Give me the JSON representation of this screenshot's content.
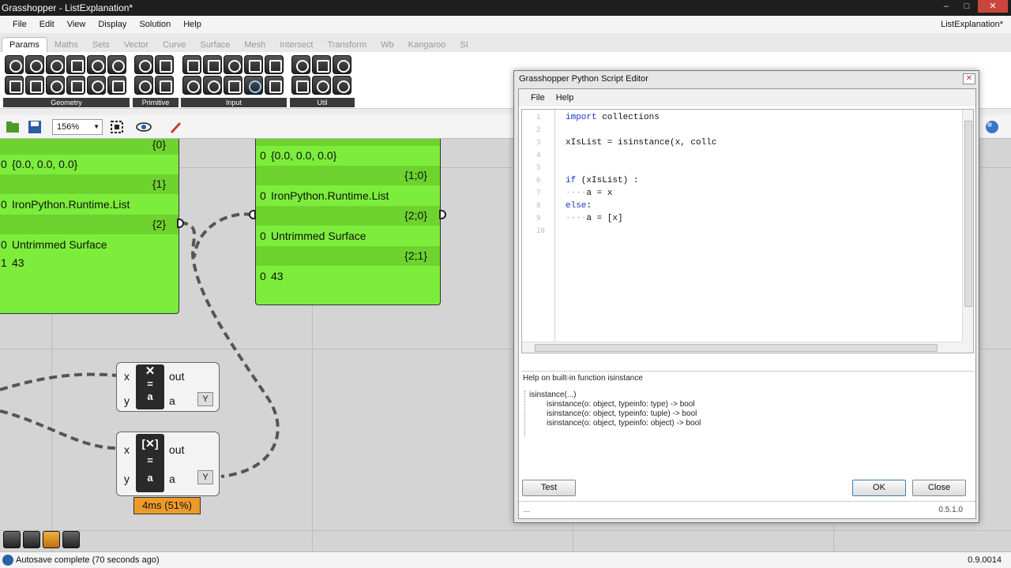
{
  "window": {
    "title": "Grasshopper - ListExplanation*",
    "right_title": "ListExplanation*",
    "controls": [
      "–",
      "□",
      "✕"
    ]
  },
  "menu": [
    "File",
    "Edit",
    "View",
    "Display",
    "Solution",
    "Help"
  ],
  "tabs": [
    "Params",
    "Maths",
    "Sets",
    "Vector",
    "Curve",
    "Surface",
    "Mesh",
    "Intersect",
    "Transform",
    "Wb",
    "Kangaroo",
    "SI"
  ],
  "ribbon_groups": [
    "Geometry",
    "Primitive",
    "Input",
    "Util"
  ],
  "toolbar": {
    "zoom": "156%"
  },
  "panel_left": {
    "rows": [
      {
        "type": "hdr",
        "text": "{0}"
      },
      {
        "type": "row",
        "idx": "0",
        "text": "{0.0, 0.0, 0.0}"
      },
      {
        "type": "hdr",
        "text": "{1}"
      },
      {
        "type": "row",
        "idx": "0",
        "text": "IronPython.Runtime.List"
      },
      {
        "type": "hdr",
        "text": "{2}"
      },
      {
        "type": "row",
        "idx": "0",
        "text": "Untrimmed Surface"
      },
      {
        "type": "row",
        "idx": "1",
        "text": "43"
      }
    ]
  },
  "panel_right": {
    "rows": [
      {
        "type": "row",
        "idx": "0",
        "text": "{0.0, 0.0, 0.0}"
      },
      {
        "type": "hdr",
        "text": "{1;0}"
      },
      {
        "type": "row",
        "idx": "0",
        "text": "IronPython.Runtime.List"
      },
      {
        "type": "hdr",
        "text": "{2;0}"
      },
      {
        "type": "row",
        "idx": "0",
        "text": "Untrimmed Surface"
      },
      {
        "type": "hdr",
        "text": "{2;1}"
      },
      {
        "type": "row",
        "idx": "0",
        "text": "43"
      }
    ]
  },
  "component_top": {
    "in_x": "x",
    "in_y": "y",
    "out": "out",
    "out_a": "a"
  },
  "component_bottom": {
    "in_x": "x",
    "in_y": "y",
    "out": "out",
    "out_a": "a"
  },
  "timer": "4ms (51%)",
  "status": "Autosave complete (70 seconds ago)",
  "version": "0.9.0014",
  "editor": {
    "title": "Grasshopper Python Script Editor",
    "menu": [
      "File",
      "Help"
    ],
    "line_numbers": [
      "1",
      "2",
      "3",
      "4",
      "5",
      "6",
      "7",
      "8",
      "9",
      "10"
    ],
    "lines": [
      "import collections",
      "",
      "xIsList = isinstance(x, collc",
      "",
      "",
      "if (xIsList) :",
      "····a = x",
      "else:",
      "····a = [x]",
      ""
    ],
    "help_title": "Help on built-in function isinstance",
    "help_lines": [
      "isinstance(...)",
      "isinstance(o: object, typeinfo: type) -> bool",
      "isinstance(o: object, typeinfo: tuple) -> bool",
      "isinstance(o: object, typeinfo: object) -> bool"
    ],
    "test_label": "Test",
    "ok_label": "OK",
    "close_label": "Close",
    "status_left": "...",
    "status_version": "0.5.1.0"
  }
}
